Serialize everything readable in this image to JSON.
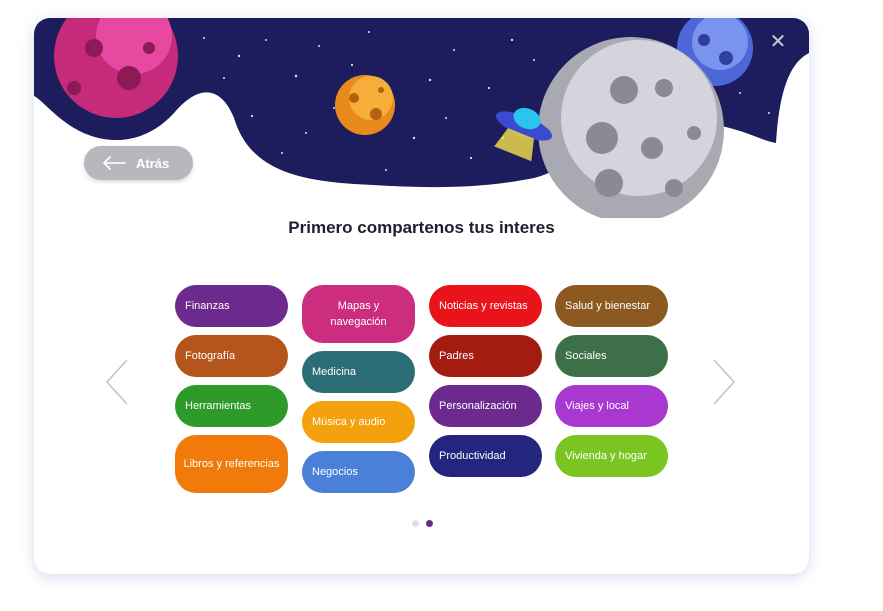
{
  "header": {
    "back_label": "Atrás",
    "title": "Primero compartenos tus interes"
  },
  "colors": {
    "space_background": "#1d1d5e",
    "back_button": "#b8b8bc",
    "active_dot": "#6a2a8c",
    "inactive_dot": "#e2dcea"
  },
  "interests": {
    "col1": [
      {
        "label": "Finanzas",
        "color": "#6d2a8e"
      },
      {
        "label": "Fotografía",
        "color": "#b4551c"
      },
      {
        "label": "Herramientas",
        "color": "#2e9a2a"
      },
      {
        "label": "Libros y referencias",
        "color": "#f07a0a"
      }
    ],
    "col2": [
      {
        "label": "Mapas y navegación",
        "color": "#cc2d7f"
      },
      {
        "label": "Medicina",
        "color": "#2b6d76"
      },
      {
        "label": "Música y audio",
        "color": "#f3a20e"
      },
      {
        "label": "Negocios",
        "color": "#4b80d8"
      }
    ],
    "col3": [
      {
        "label": "Noticias y revistas",
        "color": "#e8141a"
      },
      {
        "label": "Padres",
        "color": "#a21d10"
      },
      {
        "label": "Personalización",
        "color": "#6d2a8e"
      },
      {
        "label": "Productividad",
        "color": "#24257e"
      }
    ],
    "col4": [
      {
        "label": "Salud y bienestar",
        "color": "#8c5a20"
      },
      {
        "label": "Sociales",
        "color": "#3d7048"
      },
      {
        "label": "Viajes y local",
        "color": "#a838d0"
      },
      {
        "label": "Vivienda y hogar",
        "color": "#7ac521"
      }
    ]
  },
  "pagination": {
    "total": 2,
    "current": 2
  }
}
